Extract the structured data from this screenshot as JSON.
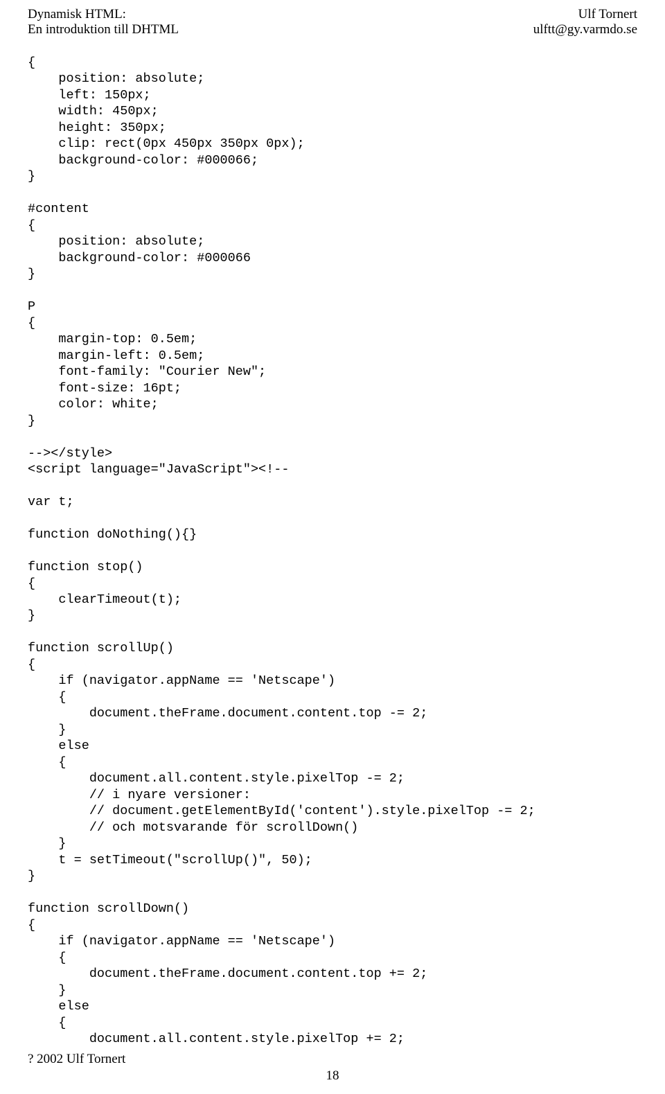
{
  "header": {
    "titleLeft1": "Dynamisk HTML:",
    "titleLeft2": "En introduktion till DHTML",
    "titleRight1": "Ulf Tornert",
    "titleRight2": "ulftt@gy.varmdo.se"
  },
  "code": "{\n    position: absolute;\n    left: 150px;\n    width: 450px;\n    height: 350px;\n    clip: rect(0px 450px 350px 0px);\n    background-color: #000066;\n}\n\n#content\n{\n    position: absolute;\n    background-color: #000066\n}\n\nP\n{\n    margin-top: 0.5em;\n    margin-left: 0.5em;\n    font-family: \"Courier New\";\n    font-size: 16pt;\n    color: white;\n}\n\n--></style>\n<script language=\"JavaScript\"><!--\n\nvar t;\n\nfunction doNothing(){}\n\nfunction stop()\n{\n    clearTimeout(t);\n}\n\nfunction scrollUp()\n{\n    if (navigator.appName == 'Netscape')\n    {\n        document.theFrame.document.content.top -= 2;\n    }\n    else\n    {\n        document.all.content.style.pixelTop -= 2;\n        // i nyare versioner:\n        // document.getElementById('content').style.pixelTop -= 2;\n        // och motsvarande för scrollDown()\n    }\n    t = setTimeout(\"scrollUp()\", 50);\n}\n\nfunction scrollDown()\n{\n    if (navigator.appName == 'Netscape')\n    {\n        document.theFrame.document.content.top += 2;\n    }\n    else\n    {\n        document.all.content.style.pixelTop += 2;",
  "footer": {
    "copyright": "? 2002 Ulf Tornert",
    "pageNumber": "18"
  }
}
